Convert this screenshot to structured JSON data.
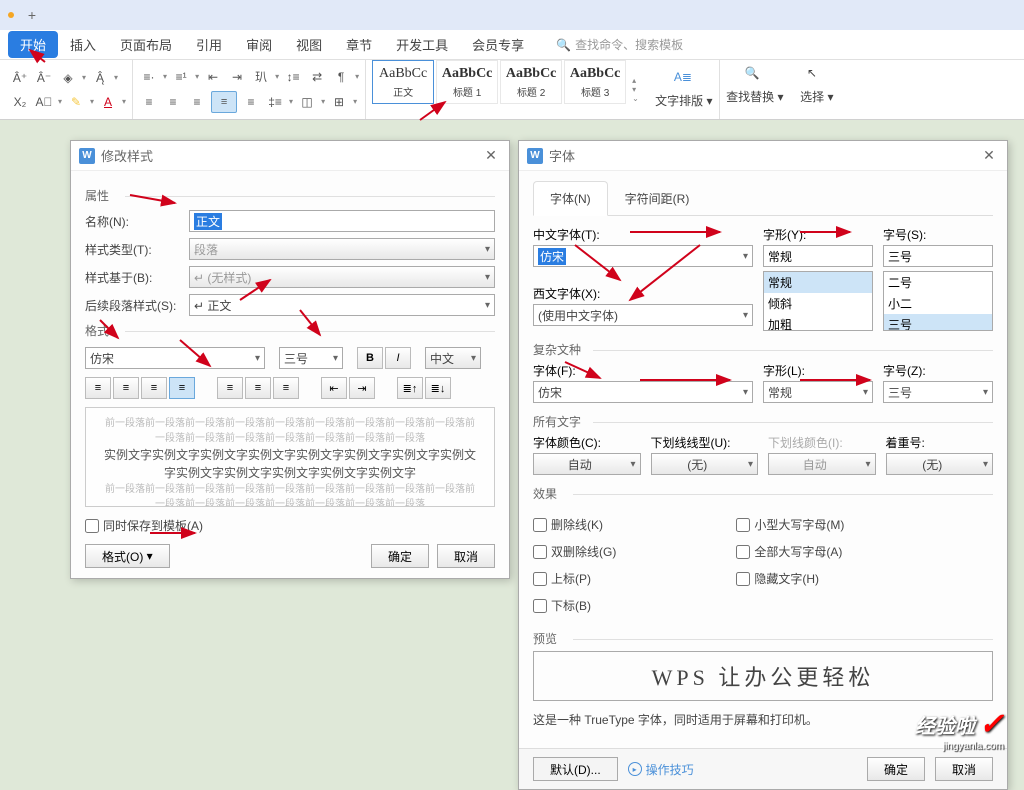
{
  "tabbar": {
    "add": "+"
  },
  "menu": {
    "items": [
      "开始",
      "插入",
      "页面布局",
      "引用",
      "审阅",
      "视图",
      "章节",
      "开发工具",
      "会员专享"
    ],
    "search_placeholder": "查找命令、搜索模板",
    "search_icon": "🔍"
  },
  "ribbon": {
    "styles": [
      {
        "sample": "AaBbCc",
        "label": "正文"
      },
      {
        "sample": "AaBbCc",
        "label": "标题 1"
      },
      {
        "sample": "AaBbCc",
        "label": "标题 2"
      },
      {
        "sample": "AaBbCc",
        "label": "标题 3"
      }
    ],
    "layout_btn": "文字排版",
    "find_btn": "查找替换",
    "select_btn": "选择"
  },
  "dlg1": {
    "title": "修改样式",
    "section_attr": "属性",
    "name_label": "名称(N):",
    "name_value": "正文",
    "type_label": "样式类型(T):",
    "type_value": "段落",
    "based_label": "样式基于(B):",
    "based_value": "↵   (无样式)",
    "next_label": "后续段落样式(S):",
    "next_value": "↵   正文",
    "section_fmt": "格式",
    "font_family": "仿宋",
    "font_size": "三号",
    "lang": "中文",
    "preview_gray": "前一段落前一段落前一段落前一段落前一段落前一段落前一段落前一段落前一段落前一段落前一段落前一段落前一段落前一段落前一段落前一段落",
    "preview_text": "实例文字实例文字实例文字实例文字实例文字实例文字实例文字实例文字实例文字实例文字实例文字实例文字实例文字",
    "save_template": "同时保存到模板(A)",
    "format_btn": "格式(O)",
    "ok": "确定",
    "cancel": "取消"
  },
  "dlg2": {
    "title": "字体",
    "tabs": [
      "字体(N)",
      "字符间距(R)"
    ],
    "cn_font_label": "中文字体(T):",
    "cn_font_value": "仿宋",
    "style_label": "字形(Y):",
    "style_value": "常规",
    "style_options": [
      "常规",
      "倾斜",
      "加粗"
    ],
    "size_label": "字号(S):",
    "size_value": "三号",
    "size_options": [
      "二号",
      "小二",
      "三号"
    ],
    "en_font_label": "西文字体(X):",
    "en_font_value": "(使用中文字体)",
    "complex_label": "复杂文种",
    "font_f_label": "字体(F):",
    "font_f_value": "仿宋",
    "style_l_label": "字形(L):",
    "style_l_value": "常规",
    "size_z_label": "字号(Z):",
    "size_z_value": "三号",
    "all_text": "所有文字",
    "color_label": "字体颜色(C):",
    "color_value": "自动",
    "underline_label": "下划线线型(U):",
    "underline_value": "(无)",
    "under_color_label": "下划线颜色(I):",
    "under_color_value": "自动",
    "emphasis_label": "着重号:",
    "emphasis_value": "(无)",
    "effects": "效果",
    "effect_items": [
      [
        "删除线(K)",
        "小型大写字母(M)"
      ],
      [
        "双删除线(G)",
        "全部大写字母(A)"
      ],
      [
        "上标(P)",
        "隐藏文字(H)"
      ],
      [
        "下标(B)",
        ""
      ]
    ],
    "preview_label": "预览",
    "preview_text": "WPS 让办公更轻松",
    "tt_note": "这是一种 TrueType 字体，同时适用于屏幕和打印机。",
    "default_btn": "默认(D)...",
    "tips": "操作技巧",
    "ok": "确定",
    "cancel": "取消"
  },
  "watermark": {
    "text": "经验啦",
    "sub": "jingyanla.com"
  }
}
